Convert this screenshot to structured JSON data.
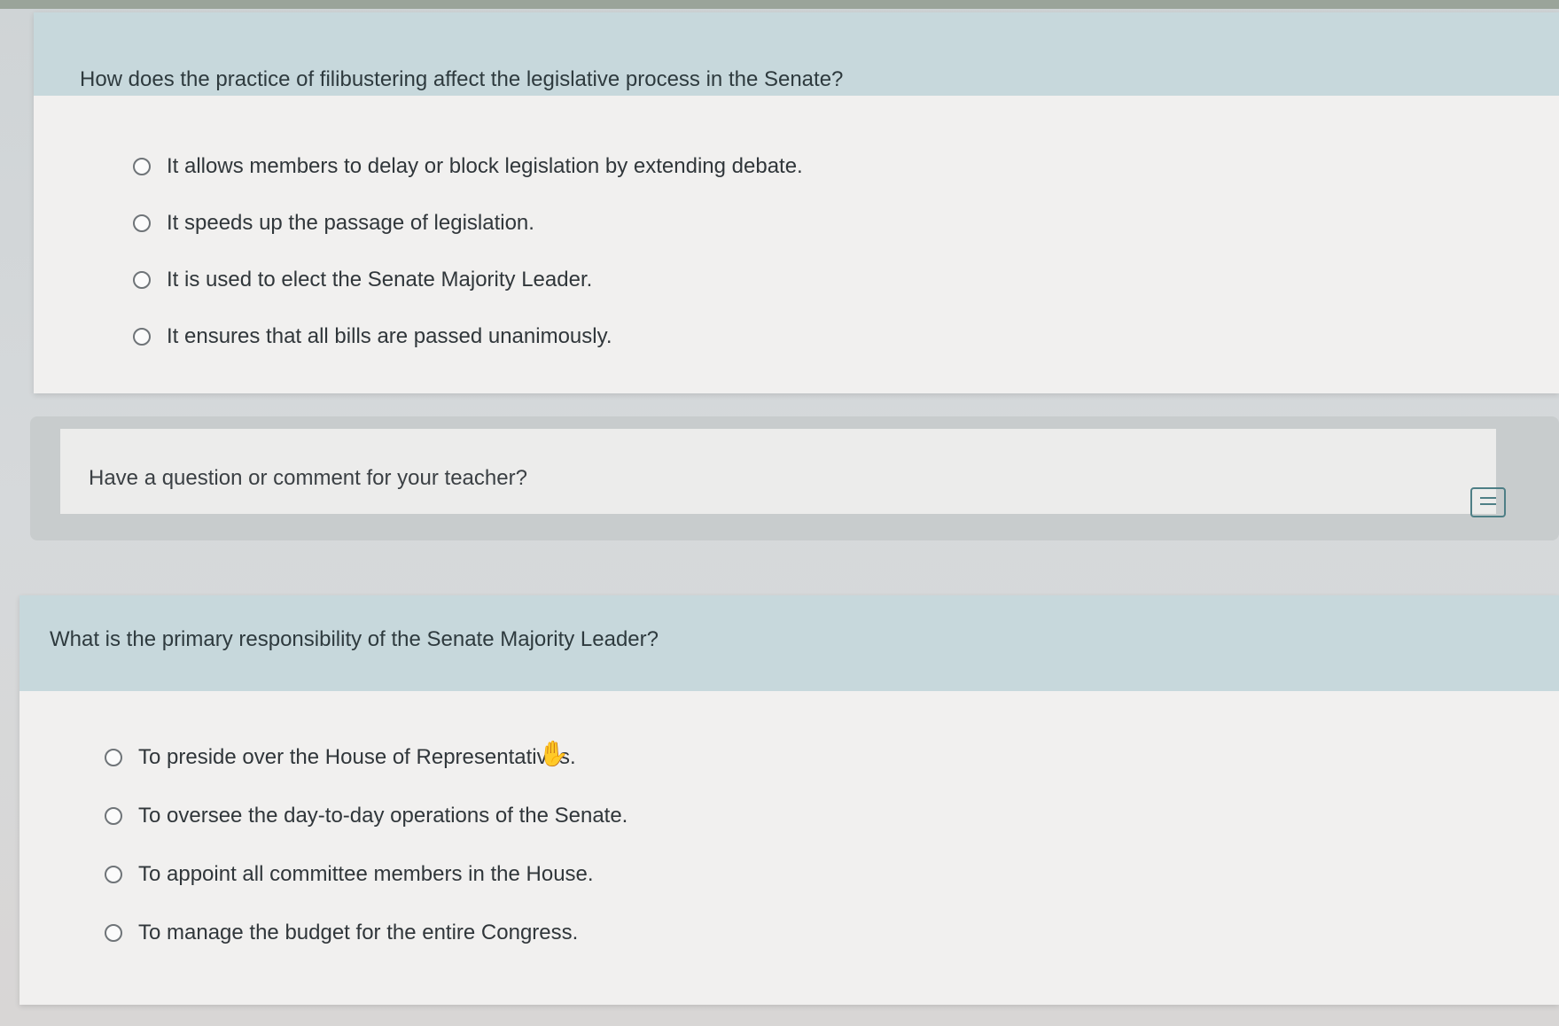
{
  "top_actions": {
    "user_icon": "user-icon",
    "menu_label": ""
  },
  "question_1": {
    "prompt": "How does the practice of filibustering affect the legislative process in the Senate?",
    "options": [
      "It allows members to delay or block legislation by extending debate.",
      "It speeds up the passage of legislation.",
      "It is used to elect the Senate Majority Leader.",
      "It ensures that all bills are passed unanimously."
    ]
  },
  "comment": {
    "label": "Have a question or comment for your teacher?",
    "icon": "comment-icon"
  },
  "question_2": {
    "prompt": "What is the primary responsibility of the Senate Majority Leader?",
    "options": [
      "To preside over the House of Representatives.",
      "To oversee the day-to-day operations of the Senate.",
      "To appoint all committee members in the House.",
      "To manage the budget for the entire Congress."
    ]
  },
  "colors": {
    "header_bg": "#c7d8dc",
    "card_bg": "#f1f0ef",
    "accent": "#4e7f86"
  }
}
